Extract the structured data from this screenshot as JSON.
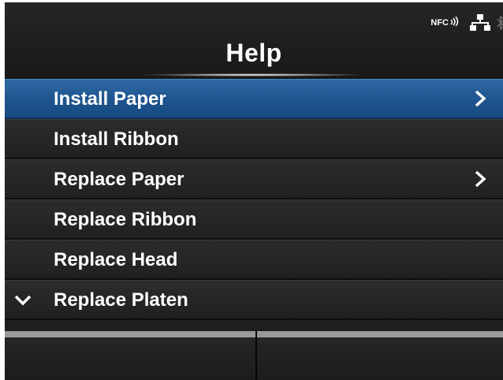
{
  "header": {
    "title": "Help",
    "status": {
      "nfc_label": "NFC"
    }
  },
  "menu": {
    "items": [
      {
        "label": "Install Paper",
        "selected": true,
        "has_submenu": true,
        "more_below": false
      },
      {
        "label": "Install Ribbon",
        "selected": false,
        "has_submenu": false,
        "more_below": false
      },
      {
        "label": "Replace Paper",
        "selected": false,
        "has_submenu": true,
        "more_below": false
      },
      {
        "label": "Replace Ribbon",
        "selected": false,
        "has_submenu": false,
        "more_below": false
      },
      {
        "label": "Replace Head",
        "selected": false,
        "has_submenu": false,
        "more_below": false
      },
      {
        "label": "Replace Platen",
        "selected": false,
        "has_submenu": false,
        "more_below": true
      }
    ]
  },
  "softkeys": {
    "left_label": "",
    "right_label": ""
  },
  "colors": {
    "selected": "#1f5590",
    "background": "#1e1e1e",
    "text": "#ffffff"
  }
}
